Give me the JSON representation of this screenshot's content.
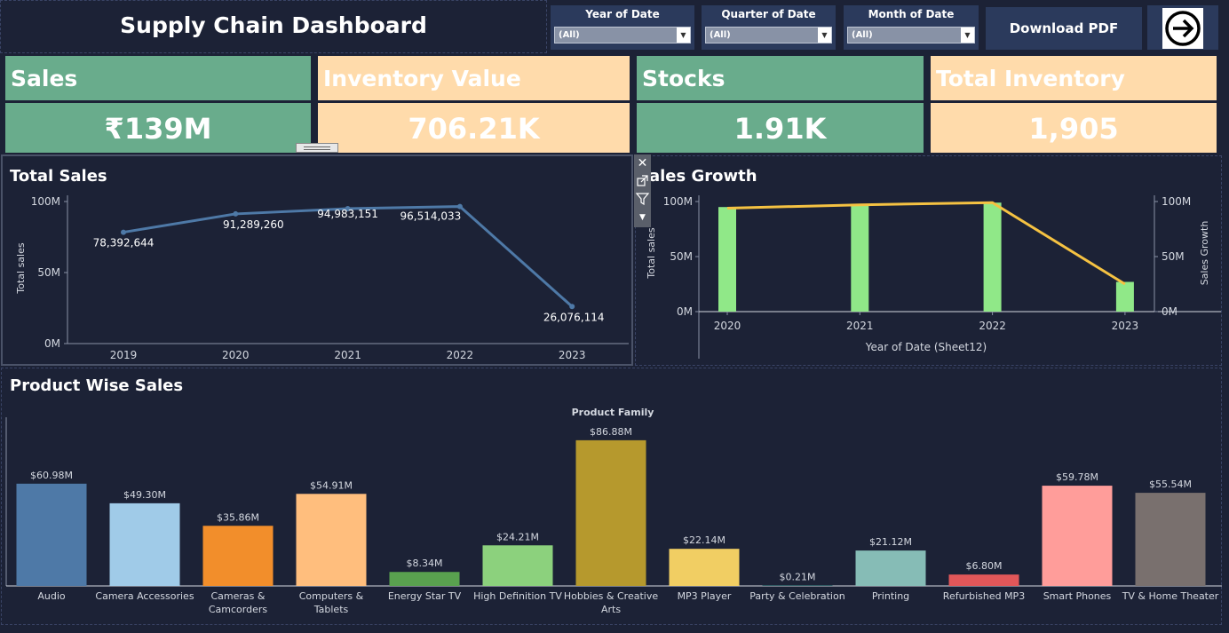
{
  "header": {
    "title": "Supply Chain Dashboard",
    "filters": [
      {
        "label": "Year of Date",
        "value": "(All)"
      },
      {
        "label": "Quarter of Date",
        "value": "(All)"
      },
      {
        "label": "Month of Date",
        "value": "(All)"
      }
    ],
    "download_label": "Download PDF",
    "nav_icon": "arrow-right-circle-icon"
  },
  "kpis": [
    {
      "title": "Sales",
      "value": "₹139M",
      "color": "#69ac8c"
    },
    {
      "title": "Inventory Value",
      "value": "706.21K",
      "color": "#ffdbab"
    },
    {
      "title": "Stocks",
      "value": "1.91K",
      "color": "#69ac8c"
    },
    {
      "title": "Total Inventory",
      "value": "1,905",
      "color": "#ffdbab"
    }
  ],
  "toolbar": {
    "close_icon": "close-icon",
    "popout_icon": "popout-icon",
    "filter_icon": "filter-icon",
    "menu_icon": "dropdown-icon"
  },
  "chart_data": [
    {
      "type": "line",
      "title": "Total Sales",
      "ylabel": "Total sales",
      "x": [
        "2019",
        "2020",
        "2021",
        "2022",
        "2023"
      ],
      "values": [
        78392644,
        91289260,
        94983151,
        96514033,
        26076114
      ],
      "data_labels": [
        "78,392,644",
        "91,289,260",
        "94,983,151",
        "96,514,033",
        "26,076,114"
      ],
      "yticks": [
        "0M",
        "50M",
        "100M"
      ],
      "ylim": [
        0,
        100000000
      ],
      "color": "#4e79a7"
    },
    {
      "type": "bar",
      "title": "Sales Growth",
      "xlabel": "Year of Date (Sheet12)",
      "ylabel": "Total sales",
      "ylabel_right": "Sales Growth",
      "categories": [
        "2020",
        "2021",
        "2022",
        "2023"
      ],
      "series": [
        {
          "kind": "bar",
          "values": [
            95,
            98,
            99,
            27
          ],
          "color": "#90e888"
        },
        {
          "kind": "line",
          "values": [
            94,
            97,
            99,
            25
          ],
          "color": "#f5c242"
        }
      ],
      "yticks": [
        "0M",
        "50M",
        "100M"
      ],
      "ylim": [
        0,
        100
      ],
      "grid": false
    },
    {
      "type": "bar",
      "title": "Product Wise Sales",
      "header": "Product Family",
      "categories": [
        "Audio",
        "Camera Accessories",
        "Cameras & Camcorders",
        "Computers & Tablets",
        "Energy Star TV",
        "High Definition TV",
        "Hobbies & Creative Arts",
        "MP3 Player",
        "Party & Celebration",
        "Printing",
        "Refurbished MP3",
        "Smart Phones",
        "TV & Home Theater"
      ],
      "category_lines": [
        [
          "Audio"
        ],
        [
          "Camera Accessories"
        ],
        [
          "Cameras &",
          "Camcorders"
        ],
        [
          "Computers &",
          "Tablets"
        ],
        [
          "Energy Star TV"
        ],
        [
          "High Definition TV"
        ],
        [
          "Hobbies & Creative",
          "Arts"
        ],
        [
          "MP3 Player"
        ],
        [
          "Party & Celebration"
        ],
        [
          "Printing"
        ],
        [
          "Refurbished MP3"
        ],
        [
          "Smart Phones"
        ],
        [
          "TV & Home Theater"
        ]
      ],
      "values": [
        60.98,
        49.3,
        35.86,
        54.91,
        8.34,
        24.21,
        86.88,
        22.14,
        0.21,
        21.12,
        6.8,
        59.78,
        55.54
      ],
      "data_labels": [
        "$60.98M",
        "$49.30M",
        "$35.86M",
        "$54.91M",
        "$8.34M",
        "$24.21M",
        "$86.88M",
        "$22.14M",
        "$0.21M",
        "$21.12M",
        "$6.80M",
        "$59.78M",
        "$55.54M"
      ],
      "colors": [
        "#4e79a7",
        "#a0cbe8",
        "#f28e2b",
        "#ffbe7d",
        "#59a14f",
        "#8cd17d",
        "#b6992d",
        "#f1ce63",
        "#499894",
        "#86bcb6",
        "#e15759",
        "#ff9d9a",
        "#79706e"
      ],
      "ylim": [
        0,
        90
      ]
    }
  ]
}
